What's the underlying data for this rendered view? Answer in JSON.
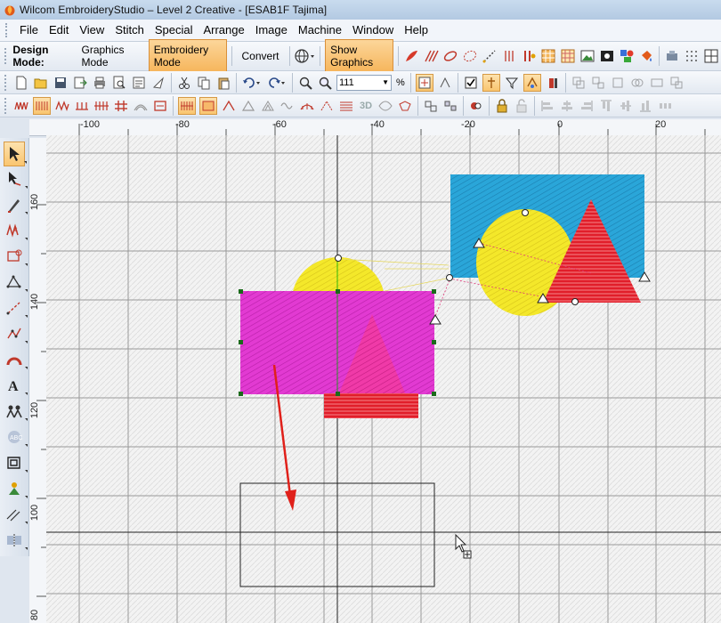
{
  "window": {
    "title": "Wilcom EmbroideryStudio – Level 2 Creative - [ESAB1F        Tajima]"
  },
  "menu": {
    "items": [
      "File",
      "Edit",
      "View",
      "Stitch",
      "Special",
      "Arrange",
      "Image",
      "Machine",
      "Window",
      "Help"
    ]
  },
  "design_mode": {
    "label": "Design Mode:",
    "graphics_mode": "Graphics Mode",
    "embroidery_mode": "Embroidery Mode",
    "convert": "Convert",
    "show_graphics": "Show Graphics"
  },
  "zoom": {
    "value": "111",
    "unit": "%"
  },
  "rulers": {
    "horizontal": [
      "-100",
      "-80",
      "-60",
      "-40",
      "-20",
      "0",
      "20"
    ],
    "vertical": [
      "160",
      "140",
      "120",
      "100",
      "80"
    ]
  },
  "colors": {
    "accent_active": "#f6b55b",
    "cyan_fill": "#2aa6d9",
    "yellow_fill": "#f4e82a",
    "magenta_fill": "#e23ad2",
    "red_fill": "#e11e2a",
    "arrow": "#e0201a"
  }
}
